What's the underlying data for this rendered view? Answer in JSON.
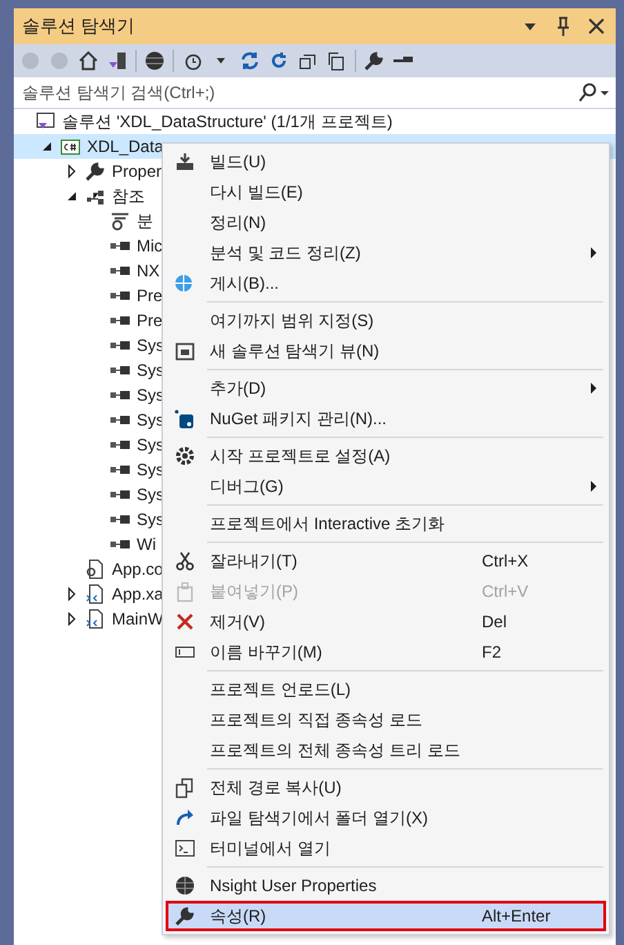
{
  "window": {
    "title": "솔루션 탐색기"
  },
  "search": {
    "placeholder": "솔루션 탐색기 검색(Ctrl+;)"
  },
  "tree": [
    {
      "label": "솔루션 'XDL_DataStructure' (1/1개 프로젝트)",
      "kind": "solution",
      "selected": false,
      "children": [
        {
          "label": "XDL_Data",
          "kind": "project",
          "selected": true,
          "expanded": true,
          "children": [
            {
              "label": "Proper",
              "kind": "properties",
              "selected": false,
              "expanded": false
            },
            {
              "label": "참조",
              "kind": "references",
              "selected": false,
              "expanded": true,
              "children": [
                {
                  "label": "분",
                  "kind": "analyzer",
                  "selected": false
                },
                {
                  "label": "Mic",
                  "kind": "reference",
                  "selected": false
                },
                {
                  "label": "NX",
                  "kind": "reference",
                  "selected": false
                },
                {
                  "label": "Pre",
                  "kind": "reference",
                  "selected": false
                },
                {
                  "label": "Pre",
                  "kind": "reference",
                  "selected": false
                },
                {
                  "label": "Sys",
                  "kind": "reference",
                  "selected": false
                },
                {
                  "label": "Sys",
                  "kind": "reference",
                  "selected": false
                },
                {
                  "label": "Sys",
                  "kind": "reference",
                  "selected": false
                },
                {
                  "label": "Sys",
                  "kind": "reference",
                  "selected": false
                },
                {
                  "label": "Sys",
                  "kind": "reference",
                  "selected": false
                },
                {
                  "label": "Sys",
                  "kind": "reference",
                  "selected": false
                },
                {
                  "label": "Sys",
                  "kind": "reference",
                  "selected": false
                },
                {
                  "label": "Sys",
                  "kind": "reference",
                  "selected": false
                },
                {
                  "label": "Wi",
                  "kind": "reference",
                  "selected": false
                }
              ]
            },
            {
              "label": "App.co",
              "kind": "config",
              "selected": false
            },
            {
              "label": "App.xa",
              "kind": "xaml",
              "selected": false,
              "expanded": false
            },
            {
              "label": "MainW",
              "kind": "xaml",
              "selected": false,
              "expanded": false
            }
          ]
        }
      ]
    }
  ],
  "context_menu": [
    {
      "kind": "item",
      "label": "빌드(U)"
    },
    {
      "kind": "item",
      "label": "다시 빌드(E)"
    },
    {
      "kind": "item",
      "label": "정리(N)"
    },
    {
      "kind": "item",
      "label": "분석 및 코드 정리(Z)",
      "submenu": true
    },
    {
      "kind": "item",
      "label": "게시(B)..."
    },
    {
      "kind": "separator"
    },
    {
      "kind": "item",
      "label": "여기까지 범위 지정(S)"
    },
    {
      "kind": "item",
      "label": "새 솔루션 탐색기 뷰(N)"
    },
    {
      "kind": "separator"
    },
    {
      "kind": "item",
      "label": "추가(D)",
      "submenu": true
    },
    {
      "kind": "item",
      "label": "NuGet 패키지 관리(N)..."
    },
    {
      "kind": "separator"
    },
    {
      "kind": "item",
      "label": "시작 프로젝트로 설정(A)"
    },
    {
      "kind": "item",
      "label": "디버그(G)",
      "submenu": true
    },
    {
      "kind": "separator"
    },
    {
      "kind": "item",
      "label": "프로젝트에서 Interactive 초기화"
    },
    {
      "kind": "separator"
    },
    {
      "kind": "item",
      "label": "잘라내기(T)",
      "shortcut": "Ctrl+X"
    },
    {
      "kind": "item",
      "label": "붙여넣기(P)",
      "shortcut": "Ctrl+V",
      "disabled": true
    },
    {
      "kind": "item",
      "label": "제거(V)",
      "shortcut": "Del"
    },
    {
      "kind": "item",
      "label": "이름 바꾸기(M)",
      "shortcut": "F2"
    },
    {
      "kind": "separator"
    },
    {
      "kind": "item",
      "label": "프로젝트 언로드(L)"
    },
    {
      "kind": "item",
      "label": "프로젝트의 직접 종속성 로드"
    },
    {
      "kind": "item",
      "label": "프로젝트의 전체 종속성 트리 로드"
    },
    {
      "kind": "separator"
    },
    {
      "kind": "item",
      "label": "전체 경로 복사(U)"
    },
    {
      "kind": "item",
      "label": "파일 탐색기에서 폴더 열기(X)"
    },
    {
      "kind": "item",
      "label": "터미널에서 열기"
    },
    {
      "kind": "separator"
    },
    {
      "kind": "item",
      "label": "Nsight User Properties"
    },
    {
      "kind": "item",
      "label": "속성(R)",
      "shortcut": "Alt+Enter",
      "selected": true,
      "outlined": true
    }
  ]
}
